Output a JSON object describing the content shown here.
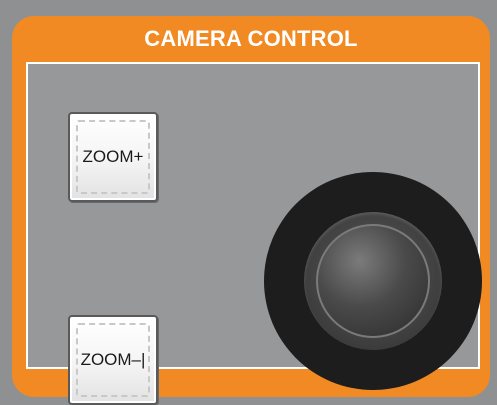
{
  "panel": {
    "title": "CAMERA CONTROL"
  },
  "buttons": {
    "zoom_in_label": "ZOOM+",
    "zoom_out_label": "ZOOM–|"
  },
  "colors": {
    "accent": "#f18a23",
    "panel_gray": "#96989a",
    "background_gray": "#8e9092",
    "joystick_base": "#1d1d1d"
  }
}
